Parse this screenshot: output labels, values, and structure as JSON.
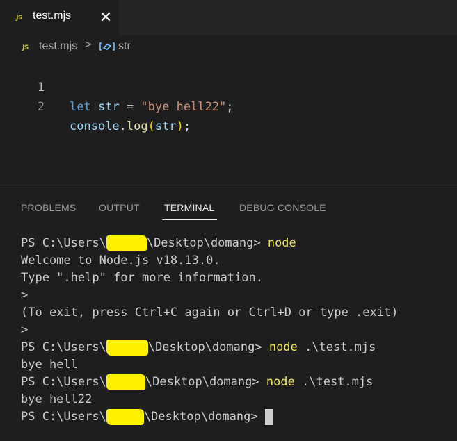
{
  "tab": {
    "icon": "javascript-file-icon",
    "icon_text": "JS",
    "label": "test.mjs",
    "close_glyph": "✕"
  },
  "breadcrumb": {
    "icon_text": "JS",
    "file": "test.mjs",
    "separator": ">",
    "symbol_icon": "variable-icon",
    "symbol": "str"
  },
  "editor": {
    "lines": [
      {
        "number": "1",
        "tokens": [
          "let",
          " ",
          "str",
          " = ",
          "\"bye hell22\"",
          ";"
        ]
      },
      {
        "number": "2",
        "tokens": [
          "console",
          ".",
          "log",
          "(",
          "str",
          ")",
          ";"
        ]
      }
    ]
  },
  "panel": {
    "tabs": [
      "PROBLEMS",
      "OUTPUT",
      "TERMINAL",
      "DEBUG CONSOLE"
    ],
    "active_tab": "TERMINAL"
  },
  "terminal": {
    "prompt_prefix": "PS C:\\Users\\",
    "prompt_suffix": "\\Desktop\\domang> ",
    "lines": [
      {
        "type": "prompt",
        "cmd": "node",
        "args": ""
      },
      {
        "type": "output",
        "text": "Welcome to Node.js v18.13.0."
      },
      {
        "type": "output",
        "text": "Type \".help\" for more information."
      },
      {
        "type": "output",
        "text": ">"
      },
      {
        "type": "output",
        "text": "(To exit, press Ctrl+C again or Ctrl+D or type .exit)"
      },
      {
        "type": "output",
        "text": ">"
      },
      {
        "type": "prompt",
        "cmd": "node",
        "args": " .\\test.mjs"
      },
      {
        "type": "output",
        "text": "bye hell"
      },
      {
        "type": "prompt",
        "cmd": "node",
        "args": " .\\test.mjs"
      },
      {
        "type": "output",
        "text": "bye hell22"
      },
      {
        "type": "prompt",
        "cmd": "",
        "args": ""
      }
    ]
  },
  "colors": {
    "editor_bg": "#1e1e1e",
    "keyword": "#569cd6",
    "string": "#ce9178",
    "command": "#f2e64f",
    "redaction": "#fff200"
  }
}
